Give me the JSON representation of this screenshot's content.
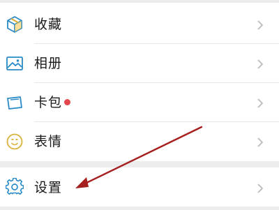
{
  "colors": {
    "icon_blue": "#2a8ac8",
    "icon_green": "#57b14a",
    "icon_yellow": "#d9b33a",
    "badge_red": "#e3474d",
    "chevron": "#b8b8b8",
    "annotation_arrow": "#a51f1f"
  },
  "menu": {
    "items": [
      {
        "label": "收藏",
        "icon": "cube-favorites-icon"
      },
      {
        "label": "相册",
        "icon": "picture-album-icon"
      },
      {
        "label": "卡包",
        "icon": "card-wallet-icon",
        "badge": "red-dot"
      },
      {
        "label": "表情",
        "icon": "smiley-emoji-icon"
      }
    ]
  },
  "settings": {
    "label": "设置",
    "icon": "gear-settings-icon"
  },
  "annotation": {
    "icon": "arrow-pointing-to-settings"
  }
}
